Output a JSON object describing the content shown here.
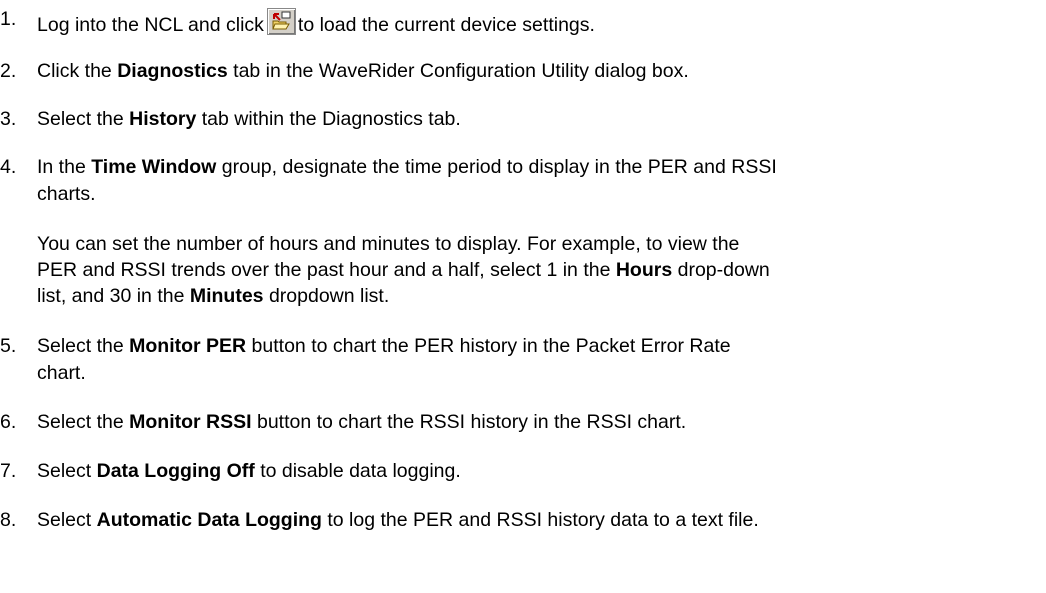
{
  "steps": [
    {
      "n": "1.",
      "pre": "Log into the NCL and click",
      "icon": "open-folder-icon",
      "post": "to load the current device settings."
    },
    {
      "n": "2.",
      "a": "Click the ",
      "b": "Diagnostics",
      "c": " tab in the WaveRider Configuration Utility dialog box."
    },
    {
      "n": "3.",
      "a": "Select the ",
      "b": "History",
      "c": " tab within the Diagnostics tab."
    },
    {
      "n": "4.",
      "a": "In the ",
      "b": "Time Window",
      "c": " group, designate the time period to display in the PER and RSSI",
      "d": "charts."
    },
    {
      "n": "5.",
      "a": "Select the ",
      "b": "Monitor PER",
      "c": " button to chart the PER history in the Packet Error Rate",
      "d": "chart."
    },
    {
      "n": "6.",
      "a": "Select the ",
      "b": "Monitor RSSI",
      "c": " button to chart the RSSI history in the RSSI chart."
    },
    {
      "n": "7.",
      "a": "Select ",
      "b": "Data Logging Off",
      "c": " to disable data logging."
    },
    {
      "n": "8.",
      "a": "Select ",
      "b": "Automatic Data Logging",
      "c": " to log the PER and RSSI history data to a text file."
    }
  ],
  "note": {
    "l1": "You can set the number of hours and minutes to display. For example, to view the",
    "l2a": "PER and RSSI trends over the past hour and a half, select 1 in the ",
    "l2b": "Hours",
    "l2c": " drop-down",
    "l3a": "list, and 30 in the ",
    "l3b": "Minutes",
    "l3c": " dropdown list."
  }
}
